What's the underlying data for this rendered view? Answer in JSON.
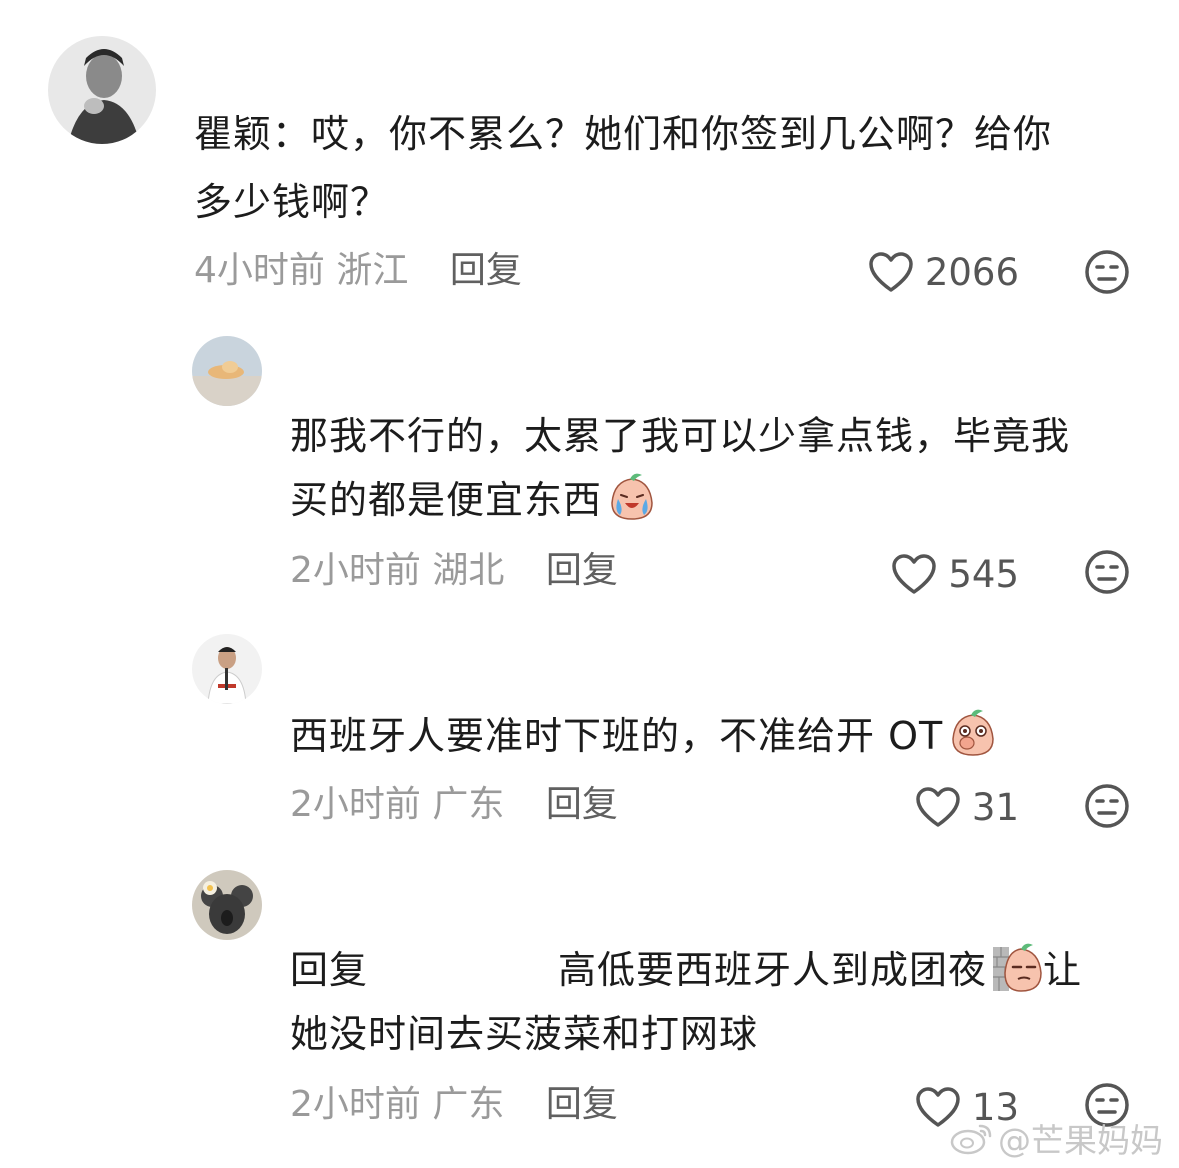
{
  "comments": [
    {
      "text_lines": [
        "瞿颖：哎，你不累么？她们和你签到几公啊？给你",
        "多少钱啊？"
      ],
      "time": "4小时前",
      "location": "浙江",
      "reply_label": "回复",
      "likes": "2066",
      "avatar_icon": "man-portrait-avatar"
    },
    {
      "text_lines": [
        "那我不行的，太累了我可以少拿点钱，毕竟我",
        "买的都是便宜东西"
      ],
      "emoji": "crying-peach-emoji",
      "time": "2小时前",
      "location": "湖北",
      "reply_label": "回复",
      "likes": "545",
      "avatar_icon": "sky-cloud-avatar"
    },
    {
      "text_lines": [
        "西班牙人要准时下班的，不准给开 OT"
      ],
      "emoji": "covering-mouth-peach-emoji",
      "time": "2小时前",
      "location": "广东",
      "reply_label": "回复",
      "likes": "31",
      "avatar_icon": "athlete-avatar"
    },
    {
      "reply_prefix": "回复",
      "text_line1_rest": "高低要西班牙人到成团夜",
      "text_line1_after_emoji": "让",
      "text_line2": "她没时间去买菠菜和打网球",
      "emoji": "peeking-wall-peach-emoji",
      "time": "2小时前",
      "location": "广东",
      "reply_label": "回复",
      "likes": "13",
      "avatar_icon": "koala-flower-avatar"
    }
  ],
  "watermark": "@芒果妈妈",
  "colors": {
    "meta": "#9a9a9a",
    "text": "#1c1c1c",
    "icon": "#555555"
  }
}
